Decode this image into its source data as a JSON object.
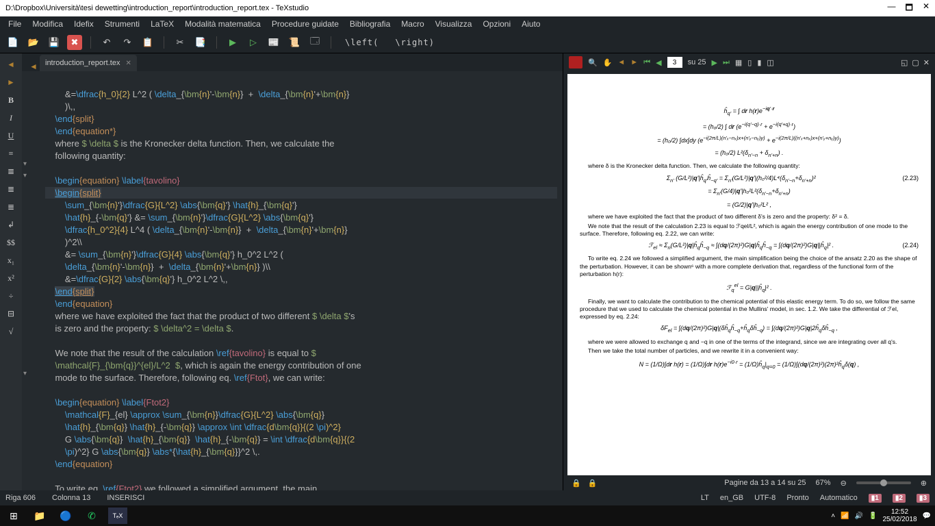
{
  "titlebar": {
    "path": "D:\\Dropbox\\Università\\tesi dewetting\\introduction_report\\introduction_report.tex - TeXstudio",
    "min": "—",
    "max": "🗖",
    "close": "✕"
  },
  "menu": {
    "file": "File",
    "edit": "Modifica",
    "idefix": "Idefix",
    "tools": "Strumenti",
    "latex": "LaTeX",
    "math": "Modalità matematica",
    "wizards": "Procedure guidate",
    "biblio": "Bibliografia",
    "macro": "Macro",
    "view": "Visualizza",
    "options": "Opzioni",
    "help": "Aiuto"
  },
  "toolbar": {
    "left": "\\left(",
    "right": "\\right)"
  },
  "tab": {
    "name": "introduction_report.tex",
    "x": "✕"
  },
  "editor": {
    "l1a": "&=",
    "l1b": "\\dfrac",
    "l1c": "{h_0}{2}",
    "l1d": " L^2 ( ",
    "l1e": "\\delta",
    "l1f": "_{",
    "l1g": "\\bm",
    "l1h": "{n}",
    "l1i": "'-",
    "l1j": "\\bm",
    "l1k": "{n}",
    "l1l": "}  +  ",
    "l1m": "\\delta",
    "l1n": "_{",
    "l1o": "\\bm",
    "l1p": "{n}",
    "l1q": "'+",
    "l1r": "\\bm",
    "l1s": "{n}",
    "l1t": "}",
    "l2": ")\\,,",
    "l3a": "\\end",
    "l3b": "{split}",
    "l4a": "\\end",
    "l4b": "{equation*}",
    "l5a": "where ",
    "l5b": "$ \\delta $",
    "l5c": " is the Kronecker delta function. Then, we calculate the",
    "l6": "following quantity:",
    "l8a": "\\begin",
    "l8b": "{equation}",
    "l8c": " \\label",
    "l8d": "{tavolino}",
    "l9a": "\\begin",
    "l9b": "{split}",
    "l10a": "\\sum",
    "l10b": "_{",
    "l10c": "\\bm",
    "l10d": "{n}",
    "l10e": "'}",
    "l10f": "\\dfrac",
    "l10g": "{G}{L^2}",
    "l10h": " \\abs",
    "l10i": "{",
    "l10j": "\\bm",
    "l10k": "{q}",
    "l10l": "'}",
    "l10m": " \\hat",
    "l10n": "{h}",
    "l10o": "_{",
    "l10p": "\\bm",
    "l10q": "{q}",
    "l10r": "'}",
    "l11a": "\\hat",
    "l11b": "{h}",
    "l11c": "_{-",
    "l11d": "\\bm",
    "l11e": "{q}",
    "l11f": "'} &= ",
    "l11g": "\\sum",
    "l11h": "_{",
    "l11i": "\\bm",
    "l11j": "{n}",
    "l11k": "'}",
    "l11l": "\\dfrac",
    "l11m": "{G}{L^2}",
    "l11n": " \\abs",
    "l11o": "{",
    "l11p": "\\bm",
    "l11q": "{q}",
    "l11r": "'}",
    "l12a": "\\dfrac",
    "l12b": "{h_0^2}{4}",
    "l12c": " L^4 ( ",
    "l12d": "\\delta",
    "l12e": "_{",
    "l12f": "\\bm",
    "l12g": "{n}",
    "l12h": "'-",
    "l12i": "\\bm",
    "l12j": "{n}",
    "l12k": "}  +  ",
    "l12l": "\\delta",
    "l12m": "_{",
    "l12n": "\\bm",
    "l12o": "{n}",
    "l12p": "'+",
    "l12q": "\\bm",
    "l12r": "{n}",
    "l12s": "}",
    "l13": ")^2\\\\",
    "l14a": "&= ",
    "l14b": "\\sum",
    "l14c": "_{",
    "l14d": "\\bm",
    "l14e": "{n}",
    "l14f": "'}",
    "l14g": "\\dfrac",
    "l14h": "{G}{4}",
    "l14i": " \\abs",
    "l14j": "{",
    "l14k": "\\bm",
    "l14l": "{q}",
    "l14m": "'} h_0^2 L^2 (",
    "l15a": "\\delta",
    "l15b": "_{",
    "l15c": "\\bm",
    "l15d": "{n}",
    "l15e": "'-",
    "l15f": "\\bm",
    "l15g": "{n}",
    "l15h": "}  +  ",
    "l15i": "\\delta",
    "l15j": "_{",
    "l15k": "\\bm",
    "l15l": "{n}",
    "l15m": "'+",
    "l15n": "\\bm",
    "l15o": "{n}",
    "l15p": "} )\\\\",
    "l16a": "&=",
    "l16b": "\\dfrac",
    "l16c": "{G}{2}",
    "l16d": " \\abs",
    "l16e": "{",
    "l16f": "\\bm",
    "l16g": "{q}",
    "l16h": "'} h_0^2 L^2 \\,,",
    "l17a": "\\end",
    "l17b": "{split}",
    "l18a": "\\end",
    "l18b": "{equation}",
    "l19a": "where we have exploited the fact that the product of two different ",
    "l19b": "$ \\delta $",
    "l19c": "'s",
    "l20a": "is zero and the property:",
    "l20b": " $ \\delta^2 = \\delta $",
    "l20c": ".",
    "l22a": "We note that the result of the calculation ",
    "l22b": "\\ref",
    "l22c": "{tavolino}",
    "l22d": " is equal to ",
    "l22e": "$",
    "l23a": "\\mathcal{F}_{\\bm{q}}^{el}/L^2  $",
    "l23b": ", which is again the energy contribution of one",
    "l24a": "mode to the surface. Therefore, following eq. ",
    "l24b": "\\ref",
    "l24c": "{Ftot}",
    "l24d": ", we can write:",
    "l26a": "\\begin",
    "l26b": "{equation}",
    "l26c": " \\label",
    "l26d": "{Ftot2}",
    "l27a": "\\mathcal",
    "l27b": "{F}",
    "l27c": "_{el} ",
    "l27d": "\\approx",
    "l27e": " \\sum",
    "l27f": "_{",
    "l27g": "\\bm",
    "l27h": "{n}",
    "l27i": "}",
    "l27j": "\\dfrac",
    "l27k": "{G}{L^2}",
    "l27l": " \\abs",
    "l27m": "{",
    "l27n": "\\bm",
    "l27o": "{q}",
    "l27p": "}",
    "l28a": "\\hat",
    "l28b": "{h}",
    "l28c": "_{",
    "l28d": "\\bm",
    "l28e": "{q}",
    "l28f": "} ",
    "l28g": "\\hat",
    "l28h": "{h}",
    "l28i": "_{-",
    "l28j": "\\bm",
    "l28k": "{q}",
    "l28l": "} ",
    "l28m": "\\approx",
    "l28n": " \\int",
    "l28o": " \\dfrac",
    "l28p": "{d",
    "l28q": "\\bm",
    "l28r": "{q}",
    "l28s": "}{(2 ",
    "l28t": "\\pi",
    "l28u": ")^2}",
    "l29a": "G ",
    "l29b": "\\abs",
    "l29c": "{",
    "l29d": "\\bm",
    "l29e": "{q}",
    "l29f": "}  ",
    "l29g": "\\hat",
    "l29h": "{h}",
    "l29i": "_{",
    "l29j": "\\bm",
    "l29k": "{q}",
    "l29l": "}  ",
    "l29m": "\\hat",
    "l29n": "{h}",
    "l29o": "_{-",
    "l29p": "\\bm",
    "l29q": "{q}",
    "l29r": "} = ",
    "l29s": "\\int",
    "l29t": " \\dfrac",
    "l29u": "{d",
    "l29v": "\\bm",
    "l29w": "{q}",
    "l29x": "}{(2",
    "l30a": "\\pi",
    "l30b": ")^2} G ",
    "l30c": "\\abs",
    "l30d": "{",
    "l30e": "\\bm",
    "l30f": "{q}",
    "l30g": "} ",
    "l30h": "\\abs*",
    "l30i": "{",
    "l30j": "\\hat",
    "l30k": "{h}",
    "l30l": "_{",
    "l30m": "\\bm",
    "l30n": "{q}",
    "l30o": "}}^2 \\,.",
    "l31a": "\\end",
    "l31b": "{equation}",
    "l33a": "To write eq. ",
    "l33b": "\\ref",
    "l33c": "{Ftot2}",
    "l33d": " we followed a simplified argument, the main"
  },
  "status": {
    "row": "Riga 606",
    "col": "Colonna 13",
    "mode": "INSERISCI",
    "lang": "en_GB",
    "enc": "UTF-8",
    "ready": "Pronto",
    "auto": "Automatico",
    "lt": "LT",
    "b1": "1",
    "b2": "2",
    "b3": "3"
  },
  "pdf": {
    "page_input": "3",
    "page_label": "su 25",
    "txt1": "where δ is the Kronecker delta function. Then, we calculate the following quantity:",
    "eq_223": "(2.23)",
    "txt2": "where we have exploited the fact that the product of two different δ's is zero and the property: δ² = δ.",
    "txt3": "We note that the result of the calculation 2.23 is equal to ℱqel/L², which is again the energy contribution of one mode to the surface. Therefore, following eq. 2.22, we can write:",
    "eq_224": "(2.24)",
    "txt4": "To write eq. 2.24 we followed a simplified argument, the main simplification being the choice of the ansatz 2.20 as the shape of the perturbation. However, it can be shown⁶ with a more complete derivation that, regardless of the functional form of the perturbation h(r):",
    "txt5": "Finally, we want to calculate the contribution to the chemical potential of this elastic energy term. To do so, we follow the same procedure that we used to calculate the chemical potential in the Mullins' model, in sec. 1.2. We take the differential of ℱel, expressed by eq. 2.24:",
    "txt6": "where we were allowed to exchange q and −q in one of the terms of the integrand, since we are integrating over all q's.",
    "txt7": "Then we take the total number of particles, and we rewrite it in a convenient way:",
    "status_pages": "Pagine da 13 a 14 su 25",
    "zoom": "67%"
  },
  "taskbar": {
    "time": "12:52",
    "date": "25/02/2018"
  }
}
